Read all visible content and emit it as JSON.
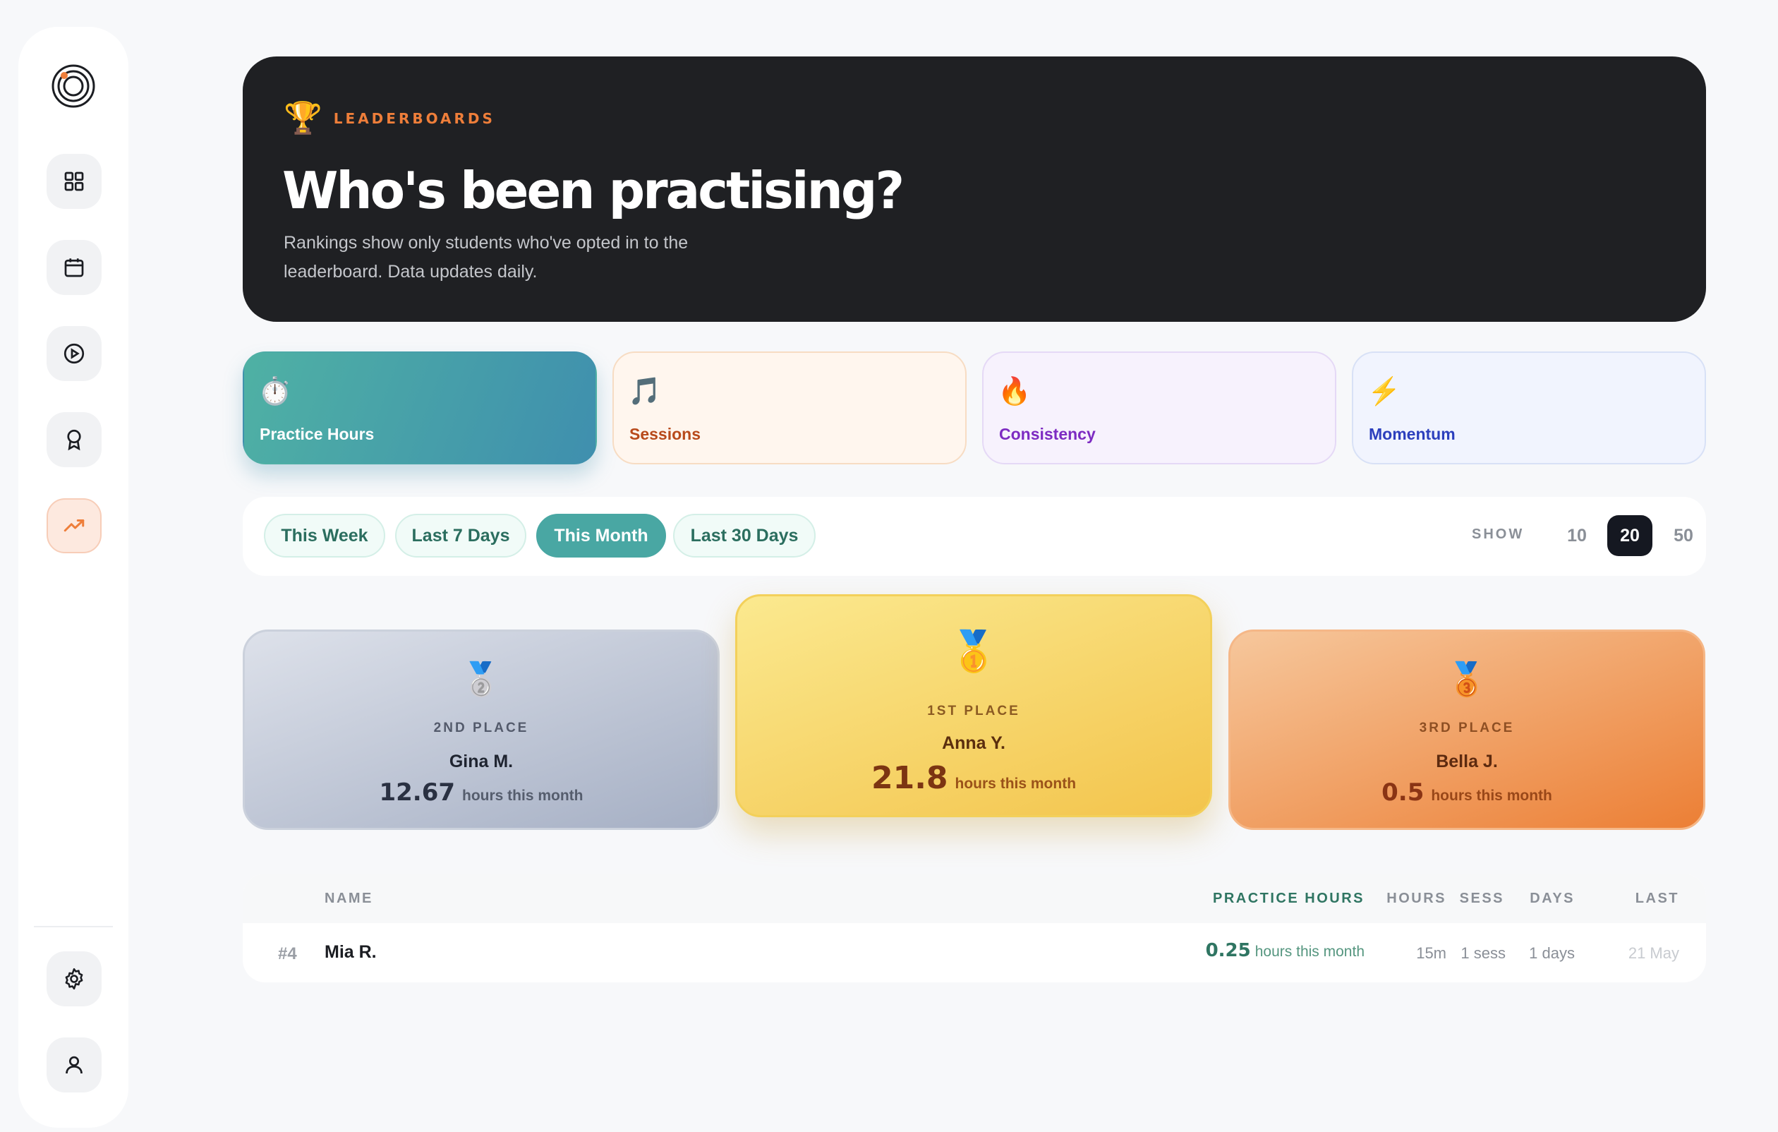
{
  "sidebar": {
    "items": [
      {
        "name": "dashboard",
        "icon": "grid-icon"
      },
      {
        "name": "calendar",
        "icon": "calendar-icon"
      },
      {
        "name": "play",
        "icon": "play-circle-icon"
      },
      {
        "name": "awards",
        "icon": "award-icon"
      },
      {
        "name": "leaderboards",
        "icon": "trending-up-icon",
        "active": true
      }
    ],
    "bottom": [
      {
        "name": "settings",
        "icon": "gear-icon"
      },
      {
        "name": "profile",
        "icon": "user-icon"
      }
    ]
  },
  "hero": {
    "eyebrow": "LEADERBOARDS",
    "title": "Who's been practising?",
    "subtitle": "Rankings show only students who've opted in to the leaderboard. Data updates daily."
  },
  "categories": [
    {
      "emoji": "⏱️",
      "label": "Practice Hours",
      "active": true
    },
    {
      "emoji": "🎵",
      "label": "Sessions"
    },
    {
      "emoji": "🔥",
      "label": "Consistency"
    },
    {
      "emoji": "⚡",
      "label": "Momentum"
    }
  ],
  "periods": [
    "This Week",
    "Last 7 Days",
    "This Month",
    "Last 30 Days"
  ],
  "active_period": "This Month",
  "show": {
    "label": "SHOW",
    "options": [
      "10",
      "20",
      "50"
    ],
    "selected": "20"
  },
  "podium": {
    "first": {
      "medal": "🥇",
      "place": "1ST PLACE",
      "name": "Anna Y.",
      "score": "21.8",
      "unit": "hours this month"
    },
    "second": {
      "medal": "🥈",
      "place": "2ND PLACE",
      "name": "Gina M.",
      "score": "12.67",
      "unit": "hours this month"
    },
    "third": {
      "medal": "🥉",
      "place": "3RD PLACE",
      "name": "Bella J.",
      "score": "0.5",
      "unit": "hours this month"
    }
  },
  "table": {
    "headers": {
      "name": "NAME",
      "practice_hours": "PRACTICE HOURS",
      "hours": "HOURS",
      "sess": "SESS",
      "days": "DAYS",
      "last": "LAST"
    },
    "rows": [
      {
        "rank": "#4",
        "name": "Mia R.",
        "score": "0.25",
        "unit": "hours this month",
        "hours": "15m",
        "sess": "1 sess",
        "days": "1 days",
        "last": "21 May"
      }
    ]
  },
  "colors": {
    "accent": "#49a7a3",
    "orange": "#ee7e3a",
    "dark": "#1f2023"
  }
}
